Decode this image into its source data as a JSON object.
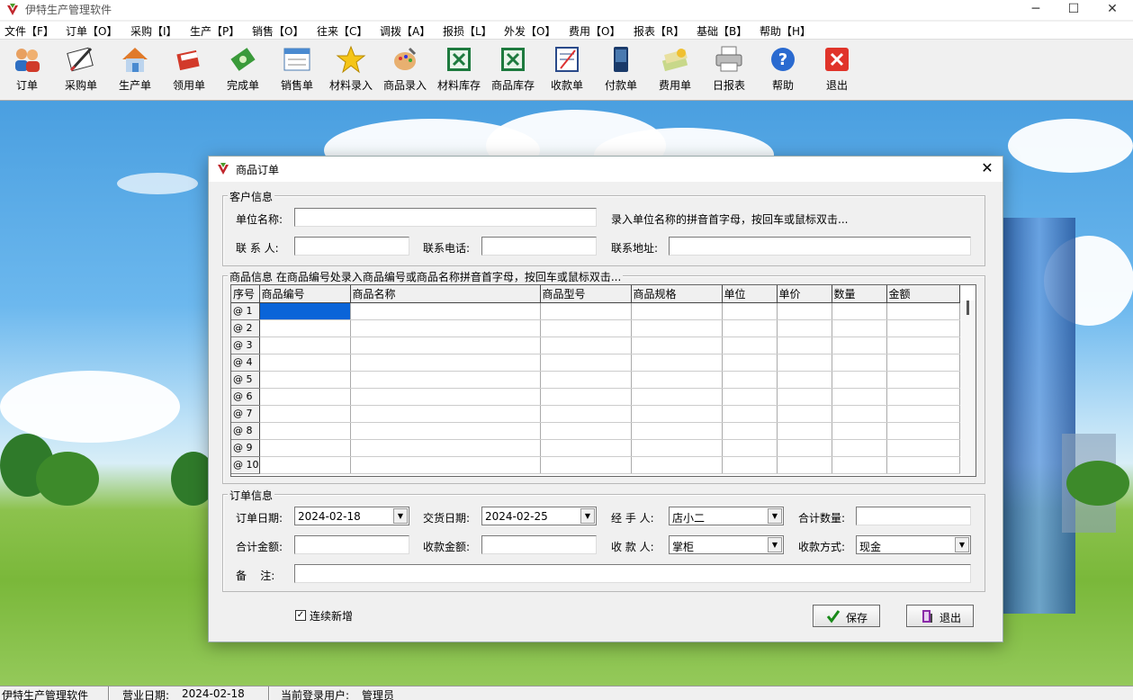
{
  "app": {
    "title": "伊特生产管理软件"
  },
  "window_controls": {
    "minimize": "─",
    "maximize": "☐",
    "close": "✕"
  },
  "menu": [
    {
      "label": "文件【F】"
    },
    {
      "label": "订单【O】"
    },
    {
      "label": "采购【I】"
    },
    {
      "label": "生产【P】"
    },
    {
      "label": "销售【O】"
    },
    {
      "label": "往来【C】"
    },
    {
      "label": "调拨【A】"
    },
    {
      "label": "报损【L】"
    },
    {
      "label": "外发【O】"
    },
    {
      "label": "费用【O】"
    },
    {
      "label": "报表【R】"
    },
    {
      "label": "基础【B】"
    },
    {
      "label": "帮助【H】"
    }
  ],
  "toolbar": [
    {
      "label": "订单",
      "icon": "users-icon"
    },
    {
      "label": "采购单",
      "icon": "purchase-icon"
    },
    {
      "label": "生产单",
      "icon": "house-icon"
    },
    {
      "label": "领用单",
      "icon": "book-icon"
    },
    {
      "label": "完成单",
      "icon": "money-icon"
    },
    {
      "label": "销售单",
      "icon": "form-icon"
    },
    {
      "label": "材料录入",
      "icon": "star-icon"
    },
    {
      "label": "商品录入",
      "icon": "paint-icon"
    },
    {
      "label": "材料库存",
      "icon": "excel-icon"
    },
    {
      "label": "商品库存",
      "icon": "excel-icon"
    },
    {
      "label": "收款单",
      "icon": "notebook-icon"
    },
    {
      "label": "付款单",
      "icon": "phone-icon"
    },
    {
      "label": "费用单",
      "icon": "cash-icon"
    },
    {
      "label": "日报表",
      "icon": "printer-icon"
    },
    {
      "label": "帮助",
      "icon": "help-icon"
    },
    {
      "label": "退出",
      "icon": "exit-icon"
    }
  ],
  "dialog": {
    "title": "商品订单",
    "close": "✕",
    "customer": {
      "legend": "客户信息",
      "company_label": "单位名称:",
      "company_value": "",
      "hint": "录入单位名称的拼音首字母，按回车或鼠标双击...",
      "contact_label": "联 系 人:",
      "contact_value": "",
      "phone_label": "联系电话:",
      "phone_value": "",
      "address_label": "联系地址:",
      "address_value": ""
    },
    "goods": {
      "legend": "商品信息 在商品编号处录入商品编号或商品名称拼音首字母，按回车或鼠标双击...",
      "columns": [
        "序号",
        "商品编号",
        "商品名称",
        "商品型号",
        "商品规格",
        "单位",
        "单价",
        "数量",
        "金额"
      ],
      "rows": [
        "@ 1",
        "@ 2",
        "@ 3",
        "@ 4",
        "@ 5",
        "@ 6",
        "@ 7",
        "@ 8",
        "@ 9",
        "@ 10"
      ]
    },
    "order": {
      "legend": "订单信息",
      "order_date_label": "订单日期:",
      "order_date": "2024-02-18",
      "delivery_date_label": "交货日期:",
      "delivery_date": "2024-02-25",
      "handler_label": "经 手 人:",
      "handler": "店小二",
      "total_qty_label": "合计数量:",
      "total_qty": "",
      "total_amount_label": "合计金额:",
      "total_amount": "",
      "received_label": "收款金额:",
      "received": "",
      "payee_label": "收 款 人:",
      "payee": "掌柜",
      "payment_method_label": "收款方式:",
      "payment_method": "现金",
      "remark_label": "备    注:",
      "remark": ""
    },
    "continuous_label": "连续新增",
    "continuous_checked": true,
    "save_label": "保存",
    "exit_label": "退出"
  },
  "status": {
    "app": "伊特生产管理软件",
    "business_date_label": "营业日期:",
    "business_date": "2024-02-18",
    "user_label": "当前登录用户:",
    "user": "管理员"
  }
}
